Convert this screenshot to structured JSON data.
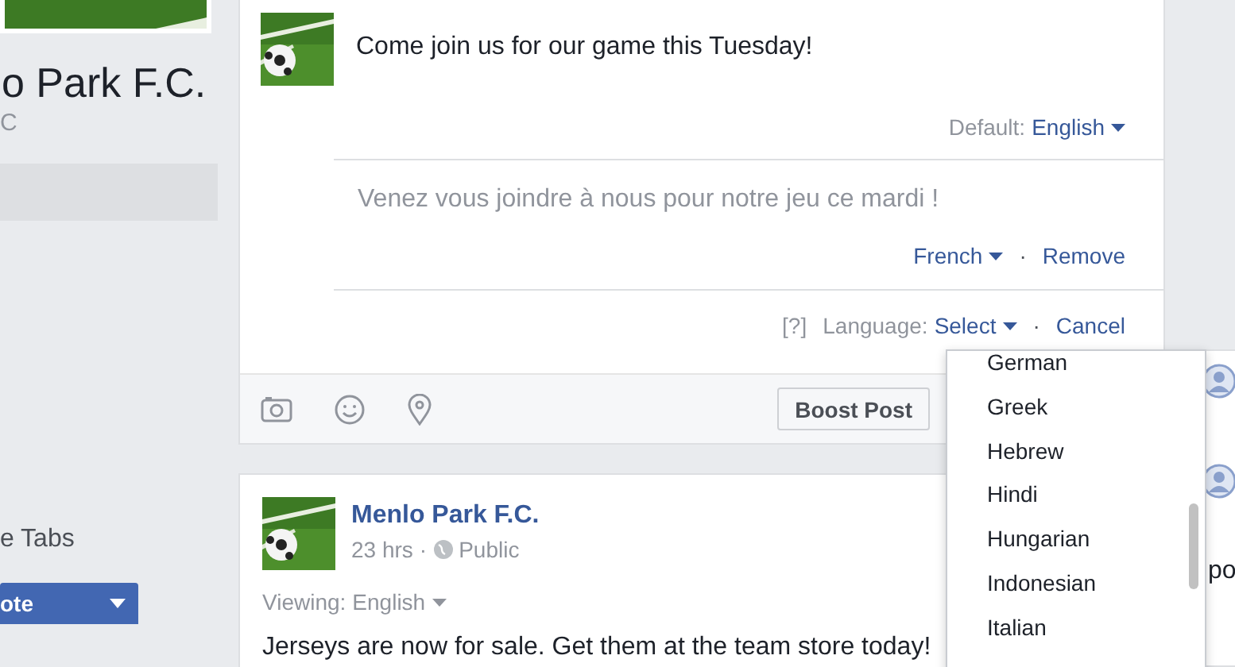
{
  "sidebar": {
    "page_name": "o Park F.C.",
    "page_category": "C",
    "more_label": "e Tabs",
    "primary_button": "ote"
  },
  "composer": {
    "post_text": "Come join us for our game this Tuesday!",
    "default_label": "Default:",
    "default_language": "English",
    "separator": "·",
    "translation": {
      "text": "Venez vous joindre à nous pour notre jeu ce mardi !",
      "language": "French",
      "remove": "Remove"
    },
    "help": "[?]",
    "language_label": "Language:",
    "language_select": "Select",
    "cancel": "Cancel",
    "boost_button": "Boost Post"
  },
  "language_menu": {
    "items": [
      {
        "label": "German",
        "selected": false
      },
      {
        "label": "Greek",
        "selected": false
      },
      {
        "label": "Hebrew",
        "selected": false
      },
      {
        "label": "Hindi",
        "selected": false
      },
      {
        "label": "Hungarian",
        "selected": false
      },
      {
        "label": "Indonesian",
        "selected": false
      },
      {
        "label": "Italian",
        "selected": false
      }
    ]
  },
  "post": {
    "author": "Menlo Park F.C.",
    "time": "23 hrs",
    "separator": "·",
    "audience": "Public",
    "viewing_label": "Viewing:",
    "viewing_language": "English",
    "text": "Jerseys are now for sale. Get them at the team store today!"
  },
  "right_panel": {
    "text": "po"
  }
}
